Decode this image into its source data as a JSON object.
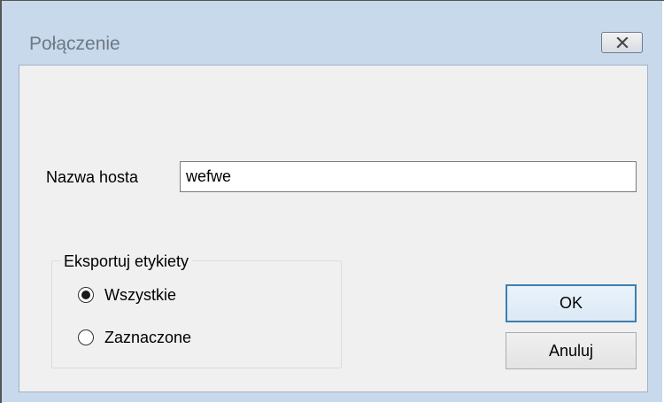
{
  "window": {
    "title": "Połączenie",
    "close_icon": "close-x-icon"
  },
  "host": {
    "label": "Nazwa hosta",
    "value": "wefwe"
  },
  "export_group": {
    "label": "Eksportuj etykiety",
    "options": [
      {
        "label": "Wszystkie",
        "selected": true
      },
      {
        "label": "Zaznaczone",
        "selected": false
      }
    ]
  },
  "buttons": {
    "ok_label": "OK",
    "cancel_label": "Anuluj"
  },
  "colors": {
    "frame": "#c7d9ea",
    "client": "#f0f0f0",
    "ok_border": "#3c7fb1"
  }
}
